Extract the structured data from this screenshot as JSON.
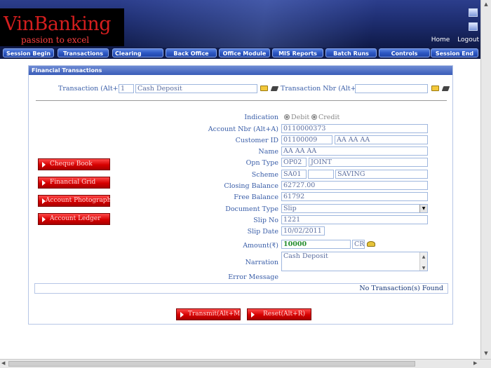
{
  "header": {
    "brand": "VinBanking",
    "tagline": "passion to excel",
    "links": [
      "Home",
      "Logout"
    ]
  },
  "nav": [
    "Session Begin",
    "Transactions",
    "Clearing",
    "Back Office",
    "Office Module",
    "MIS Reports",
    "Batch Runs",
    "Controls",
    "Session End"
  ],
  "panel": {
    "title": "Financial Transactions",
    "transaction_label": "Transaction (Alt+T)",
    "transaction_code": "1",
    "transaction_name": "Cash Deposit",
    "transaction_nbr_label": "Transaction Nbr (Alt+N)",
    "transaction_nbr_value": ""
  },
  "form": {
    "indication_label": "Indication",
    "debit_label": "Debit",
    "credit_label": "Credit",
    "account_nbr_label": "Account Nbr (Alt+A)",
    "account_nbr": "0110000373",
    "customer_id_label": "Customer ID",
    "customer_id": "01100009",
    "customer_short": "AA AA AA",
    "name_label": "Name",
    "name": "AA AA AA",
    "opn_type_label": "Opn Type",
    "opn_type_code": "OP02",
    "opn_type_name": "JOINT",
    "scheme_label": "Scheme",
    "scheme_code": "SA01",
    "scheme_mid": "",
    "scheme_name": "SAVING",
    "closing_balance_label": "Closing Balance",
    "closing_balance": "62727.00",
    "free_balance_label": "Free Balance",
    "free_balance": "61792",
    "document_type_label": "Document Type",
    "document_type": "Slip",
    "slip_no_label": "Slip No",
    "slip_no": "1221",
    "slip_date_label": "Slip Date",
    "slip_date": "10/02/2011",
    "amount_label": "Amount(",
    "rupee": "₹",
    "amount_close": ")",
    "amount": "10000",
    "amount_type": "CR",
    "narration_label": "Narration",
    "narration": "Cash Deposit",
    "error_label": "Error Message",
    "status_message": "No Transaction(s) Found"
  },
  "side_buttons": [
    "Cheque Book",
    "Financial Grid",
    "Account Photograph",
    "Account Ledger"
  ],
  "actions": {
    "transmit": "Transmit(Alt+M)",
    "reset": "Reset(Alt+R)"
  },
  "colors": {
    "accent": "#2d58c4",
    "danger": "#d60000",
    "header": "#1f2f73"
  }
}
